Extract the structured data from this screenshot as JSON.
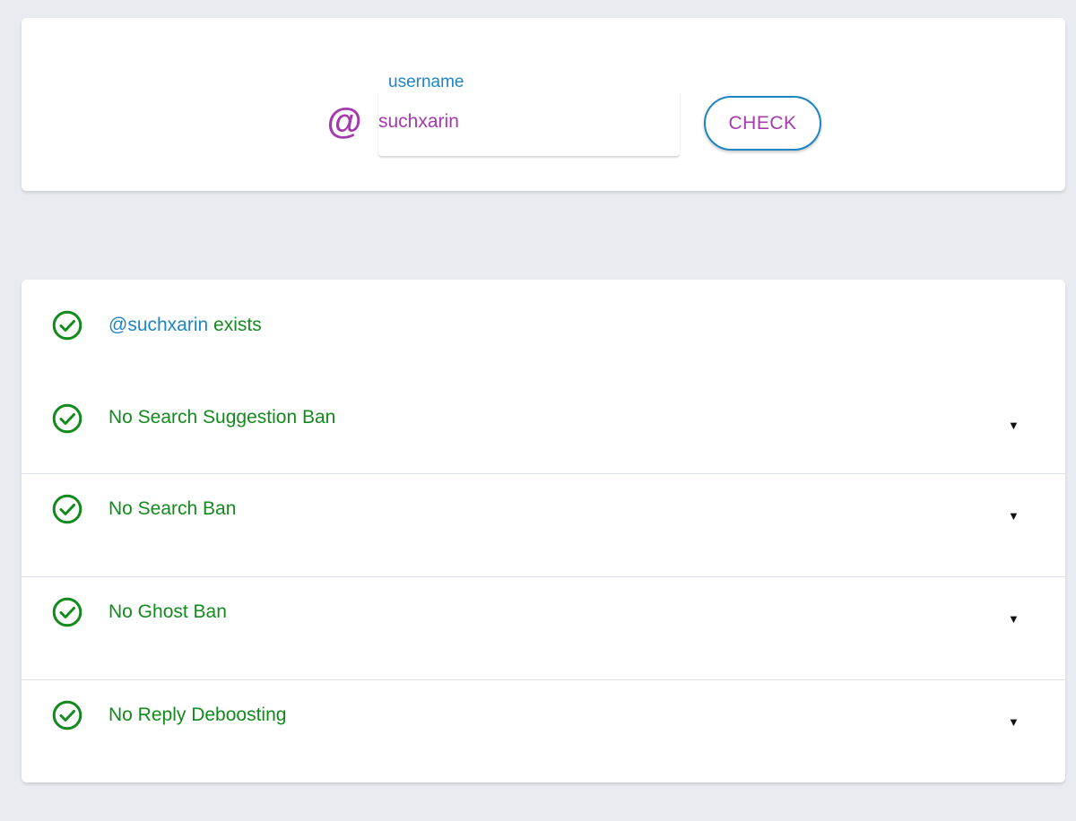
{
  "search": {
    "at_symbol": "@",
    "label": "username",
    "value": "suchxarin",
    "button_label": "CHECK"
  },
  "results": {
    "exists": {
      "username": "@suchxarin",
      "text": "exists",
      "icon": "check-circle-icon"
    },
    "items": [
      {
        "label": "No Search Suggestion Ban",
        "icon": "check-circle-icon"
      },
      {
        "label": "No Search Ban",
        "icon": "check-circle-icon"
      },
      {
        "label": "No Ghost Ban",
        "icon": "check-circle-icon"
      },
      {
        "label": "No Reply Deboosting",
        "icon": "check-circle-icon"
      }
    ],
    "caret": "▼"
  },
  "colors": {
    "background": "#e8ecf0",
    "accent_purple": "#a53aad",
    "accent_blue": "#1e84c2",
    "success_green": "#138a1d"
  }
}
